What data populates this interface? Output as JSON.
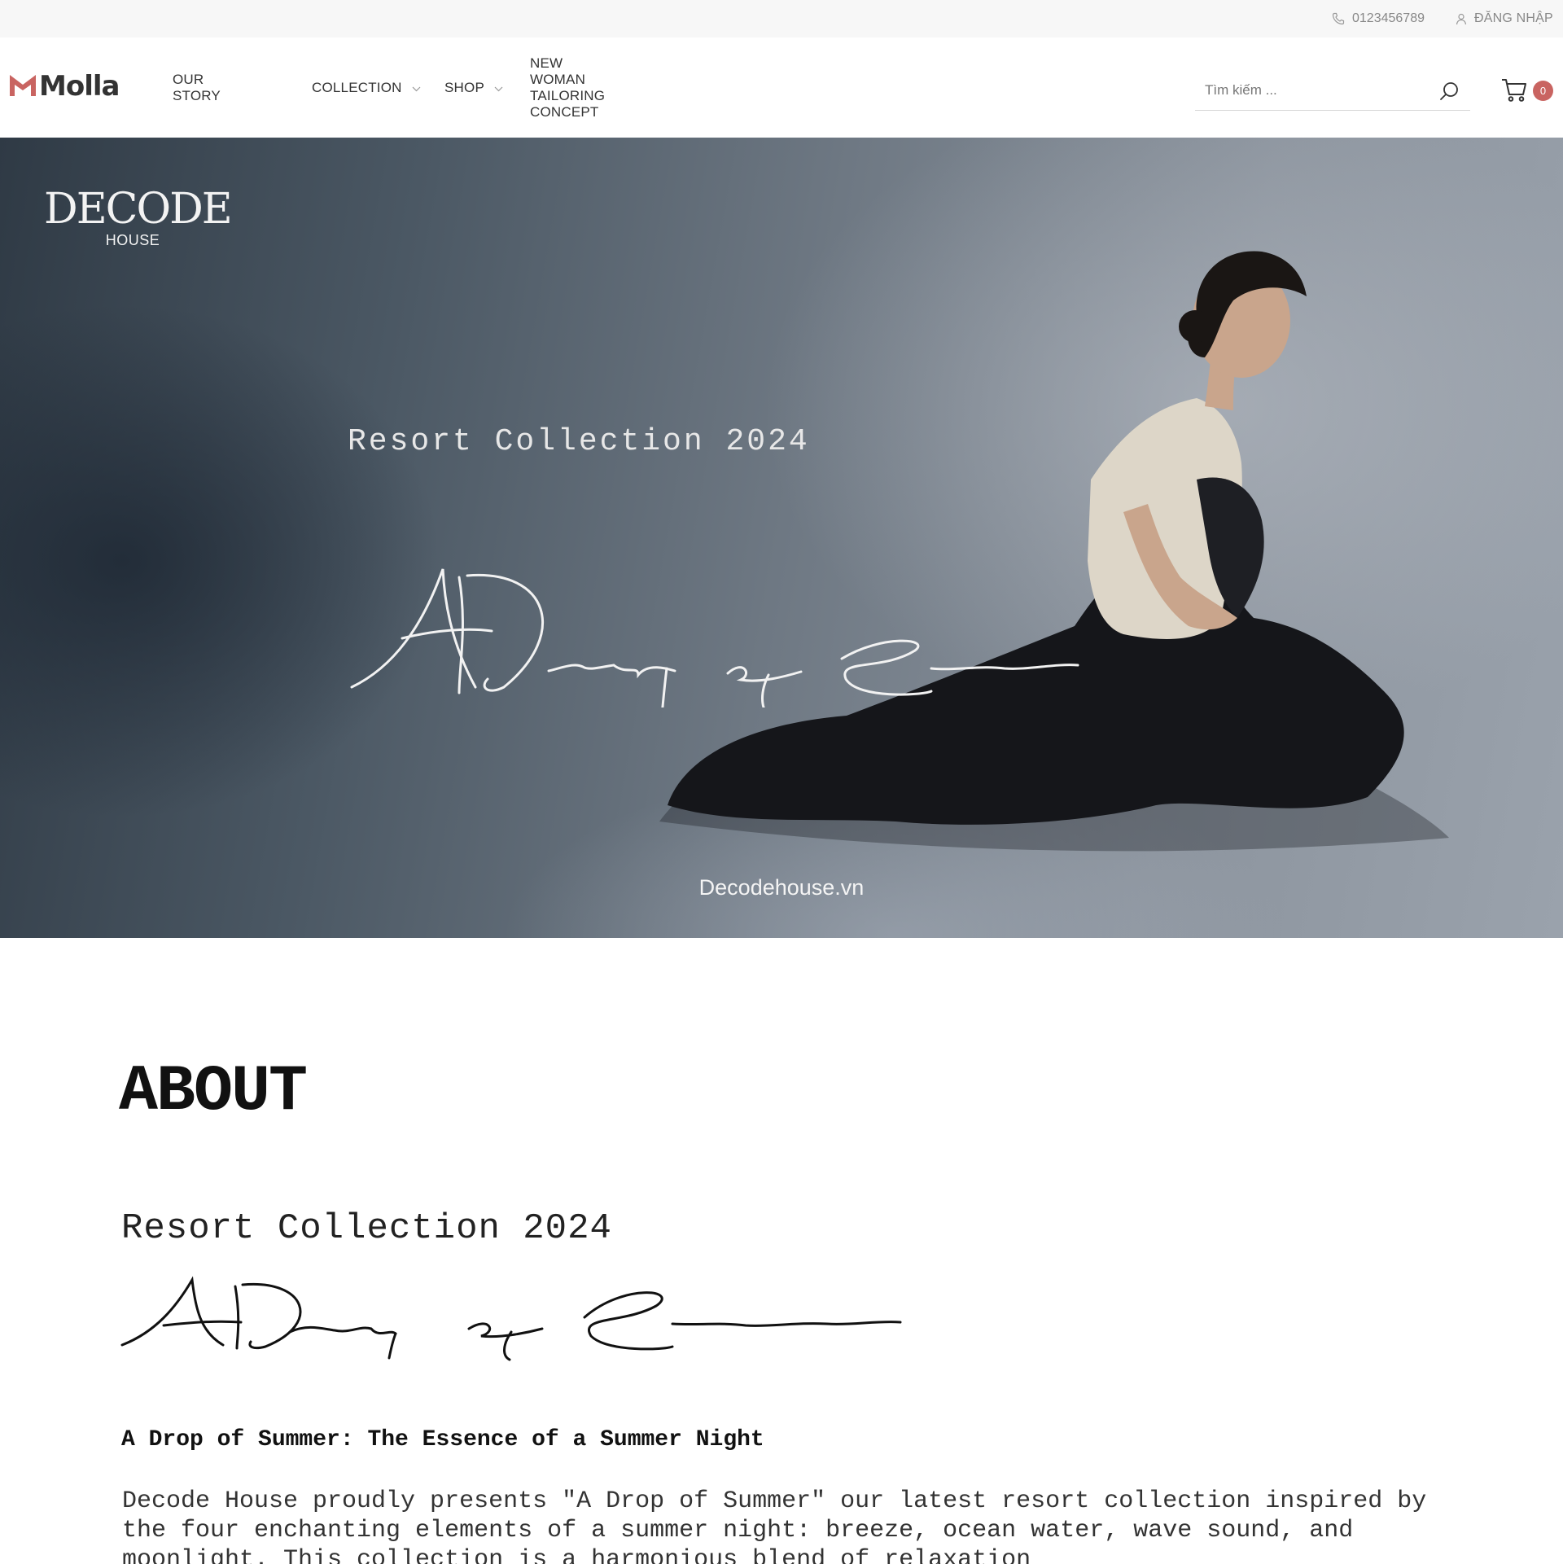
{
  "topbar": {
    "phone": "0123456789",
    "login": "ĐĂNG NHẬP",
    "phone_icon": "phone-icon",
    "user_icon": "user-icon"
  },
  "header": {
    "logo_text": "Molla",
    "logo_color": "#c96461",
    "nav": [
      {
        "label": "OUR STORY",
        "has_dropdown": false
      },
      {
        "label": "COLLECTION",
        "has_dropdown": true
      },
      {
        "label": "SHOP",
        "has_dropdown": true
      },
      {
        "label": "NEW WOMAN TAILORING CONCEPT",
        "has_dropdown": false
      }
    ],
    "search_placeholder": "Tìm kiếm ...",
    "cart_count": "0",
    "accent": "#c96461"
  },
  "hero": {
    "brand_line1": "DECODE",
    "brand_line2": "HOUSE",
    "title": "Resort Collection 2024",
    "script": "A Drop of Summer",
    "site": "Decodehouse.vn"
  },
  "about": {
    "heading": "ABOUT",
    "subtitle": "Resort Collection 2024",
    "script": "A Drop of Summer",
    "h3": "A Drop of Summer: The Essence of a Summer Night",
    "paragraph": "Decode House proudly presents \"A Drop of Summer\" our latest resort collection inspired by the four enchanting elements of a summer night: breeze, ocean water, wave sound, and moonlight. This collection is a harmonious blend of relaxation"
  }
}
